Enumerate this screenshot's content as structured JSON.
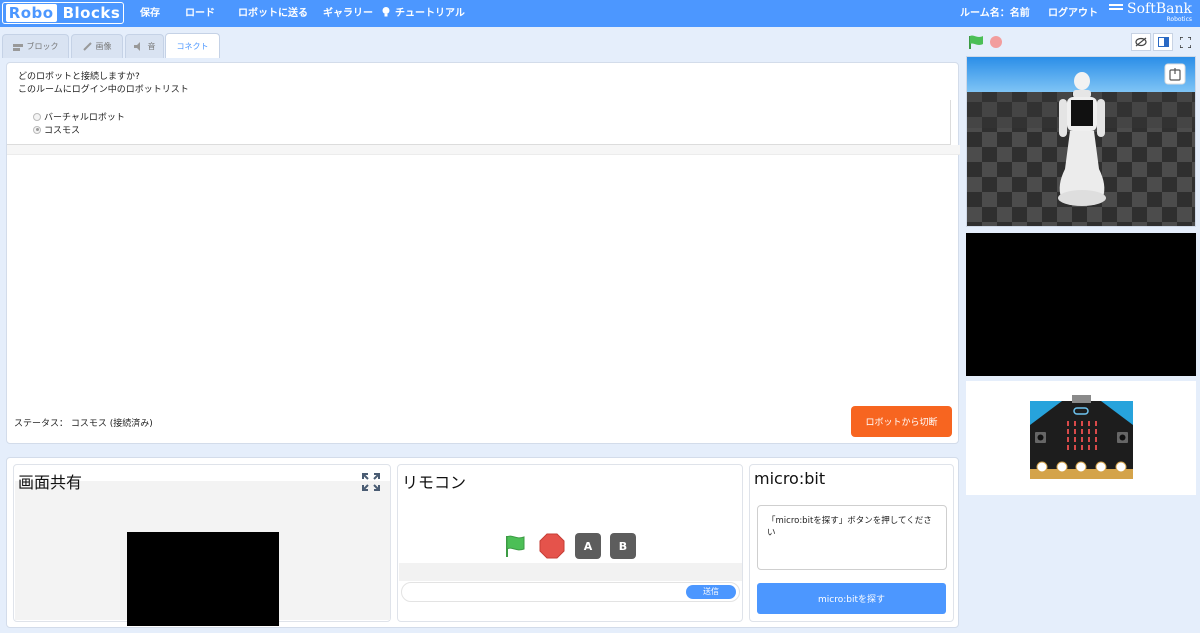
{
  "app": {
    "logo_part1": "Robo",
    "logo_part2": "Blocks"
  },
  "menu": {
    "save": "保存",
    "load": "ロード",
    "send_to_robot": "ロボットに送る",
    "gallery": "ギャラリー",
    "tutorial": "チュートリアル",
    "room_name": "ルーム名：名前",
    "logout": "ログアウト",
    "brand": "SoftBank",
    "brand_sub": "Robotics"
  },
  "tabs": [
    {
      "label": "ブロック",
      "icon": "blocks-icon"
    },
    {
      "label": "画像",
      "icon": "brush-icon"
    },
    {
      "label": "音",
      "icon": "speaker-icon"
    },
    {
      "label": "コネクト",
      "icon": "",
      "active": true
    }
  ],
  "connect": {
    "question": "どのロボットと接続しますか?",
    "list_caption": "このルームにログイン中のロボットリスト",
    "robots": [
      {
        "label": "バーチャルロボット",
        "selected": false
      },
      {
        "label": "コスモス",
        "selected": true
      }
    ],
    "status": "ステータス： コスモス (接続済み)",
    "disconnect_label": "ロボットから切断"
  },
  "screen_share": {
    "title": "画面共有"
  },
  "remote": {
    "title": "リモコン",
    "btn_a": "A",
    "btn_b": "B",
    "send_label": "送信",
    "input_value": ""
  },
  "microbit": {
    "title": "micro:bit",
    "message": "「micro:bitを探す」ボタンを押してください",
    "find_label": "micro:bitを探す"
  },
  "colors": {
    "accent": "#4c97ff",
    "danger": "#f76520",
    "flag": "#4cbf56",
    "stop": "#e5534b"
  }
}
